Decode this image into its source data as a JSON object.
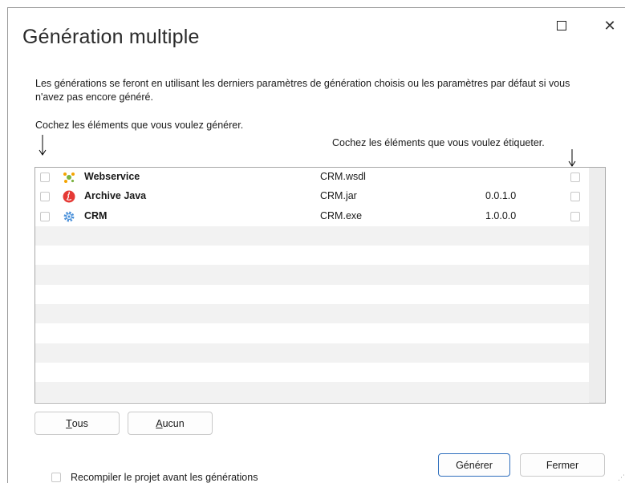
{
  "window": {
    "title": "Génération multiple",
    "maximize_icon": "maximize-icon",
    "close_icon": "close-icon"
  },
  "description": "Les générations se feront en utilisant les derniers paramètres de génération choisis ou les paramètres par défaut si vous n'avez pas encore généré.",
  "hints": {
    "left": "Cochez les éléments que vous voulez générer.",
    "right": "Cochez les éléments que vous voulez étiqueter."
  },
  "items": [
    {
      "name": "Webservice",
      "file": "CRM.wsdl",
      "version": "",
      "icon": "webservice-icon",
      "generate": false,
      "label": false
    },
    {
      "name": "Archive Java",
      "file": "CRM.jar",
      "version": "0.0.1.0",
      "icon": "java-archive-icon",
      "generate": false,
      "label": false
    },
    {
      "name": "CRM",
      "file": "CRM.exe",
      "version": "1.0.0.0",
      "icon": "gear-icon",
      "generate": false,
      "label": false
    }
  ],
  "buttons": {
    "all": {
      "mnemonic": "T",
      "rest": "ous"
    },
    "none": {
      "mnemonic": "A",
      "rest": "ucun"
    },
    "generate": "Générer",
    "close": "Fermer"
  },
  "recompile": {
    "label": "Recompiler le projet avant les générations",
    "checked": false
  },
  "colors": {
    "accent": "#2f6fbd",
    "alt_row": "#f2f2f2"
  }
}
